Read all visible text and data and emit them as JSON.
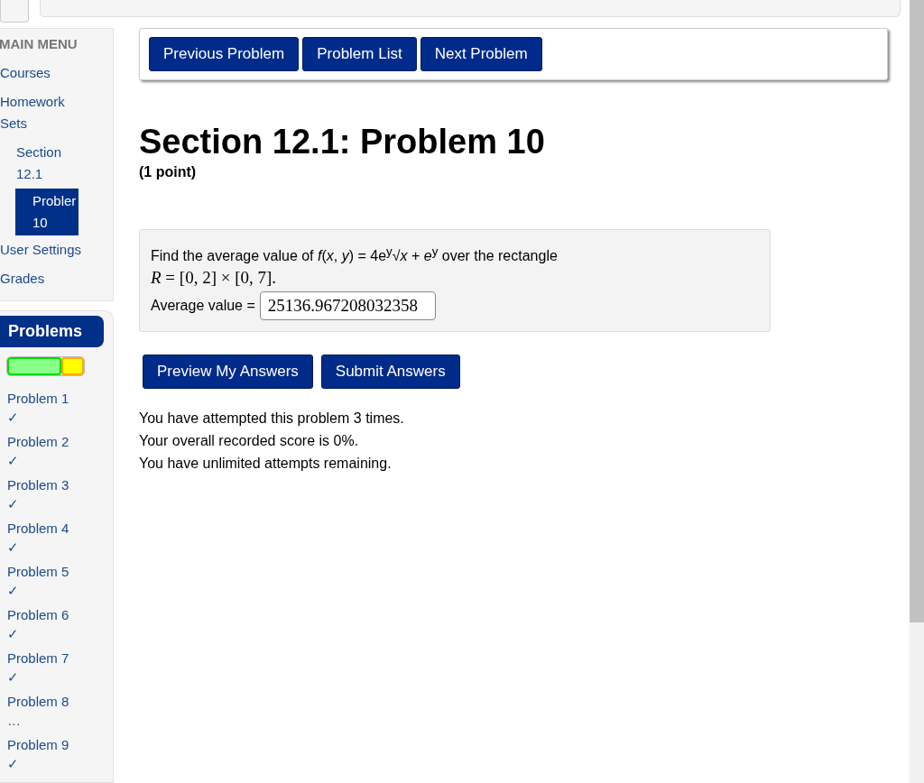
{
  "main_menu": {
    "title": "MAIN MENU",
    "items": [
      {
        "label": "Courses",
        "selected": false
      },
      {
        "label": "Homework Sets",
        "selected": false,
        "children": [
          {
            "label": "Section 12.1",
            "selected": false,
            "children": [
              {
                "label": "Probler 10",
                "selected": true
              }
            ]
          }
        ]
      },
      {
        "label": "User Settings",
        "selected": false
      },
      {
        "label": "Grades",
        "selected": false
      }
    ]
  },
  "problems_panel": {
    "title": "Problems",
    "progress": {
      "level": 0.7
    },
    "items": [
      {
        "label": "Problem 1",
        "status": "✓"
      },
      {
        "label": "Problem 2",
        "status": "✓"
      },
      {
        "label": "Problem 3",
        "status": "✓"
      },
      {
        "label": "Problem 4",
        "status": "✓"
      },
      {
        "label": "Problem 5",
        "status": "✓"
      },
      {
        "label": "Problem 6",
        "status": "✓"
      },
      {
        "label": "Problem 7",
        "status": "✓"
      },
      {
        "label": "Problem 8",
        "status": "…"
      },
      {
        "label": "Problem 9",
        "status": "✓"
      }
    ]
  },
  "nav_buttons": [
    "Previous Problem",
    "Problem List",
    "Next Problem"
  ],
  "title": "Section 12.1: Problem 10",
  "points": "(1 point)",
  "problem": {
    "statement": "Find the average value of *f*(*x*, *y*) = 4e$^{y}$√*x* + *e*$^{y}$ over the rectangle",
    "region": "*R* = [0, 2] × [0, 7].",
    "answer_label": "Average value =",
    "answer_value": "25136.967208032358"
  },
  "action_buttons": [
    "Preview My Answers",
    "Submit Answers"
  ],
  "messages": [
    "You have attempted this problem 3 times.",
    "Your overall recorded score is 0%.",
    "You have unlimited attempts remaining."
  ]
}
